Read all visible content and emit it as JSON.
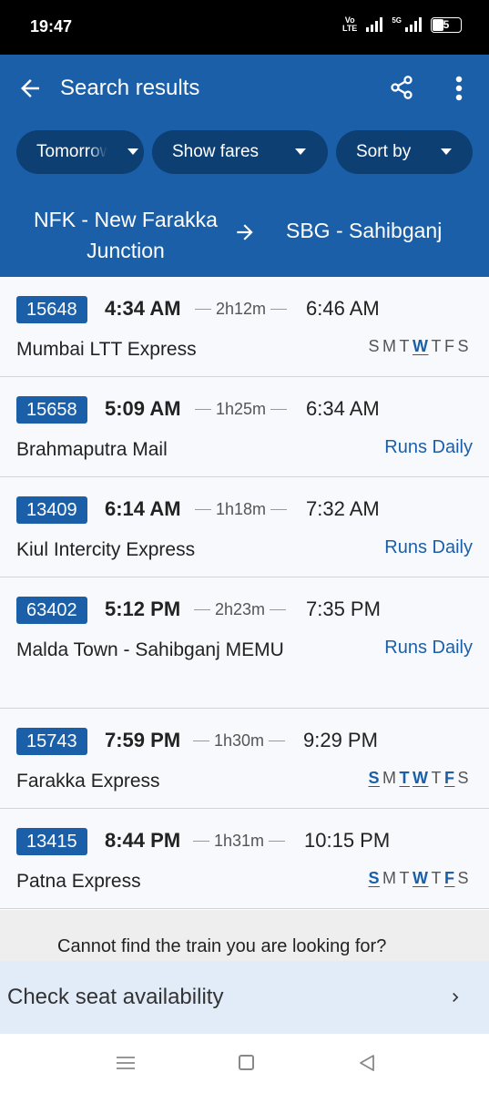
{
  "status": {
    "time": "19:47",
    "network_label": "Vo\nLTE",
    "g5": "5G",
    "battery": "5"
  },
  "header": {
    "title": "Search results"
  },
  "filters": {
    "date_label": "Tomorrow",
    "fares_label": "Show fares",
    "sort_label": "Sort by"
  },
  "route": {
    "from": "NFK - New Farakka Junction",
    "to": "SBG - Sahibganj"
  },
  "trains": [
    {
      "number": "15648",
      "dep": "4:34 AM",
      "dur": "2h12m",
      "arr": "6:46 AM",
      "name": "Mumbai LTT Express",
      "days": [
        {
          "d": "S",
          "on": false
        },
        {
          "d": "M",
          "on": false
        },
        {
          "d": "T",
          "on": false
        },
        {
          "d": "W",
          "on": true
        },
        {
          "d": "T",
          "on": false
        },
        {
          "d": "F",
          "on": false
        },
        {
          "d": "S",
          "on": false
        }
      ]
    },
    {
      "number": "15658",
      "dep": "5:09 AM",
      "dur": "1h25m",
      "arr": "6:34 AM",
      "name": "Brahmaputra Mail",
      "runs": "Runs Daily"
    },
    {
      "number": "13409",
      "dep": "6:14 AM",
      "dur": "1h18m",
      "arr": "7:32 AM",
      "name": "Kiul Intercity Express",
      "runs": "Runs Daily"
    },
    {
      "number": "63402",
      "dep": "5:12 PM",
      "dur": "2h23m",
      "arr": "7:35 PM",
      "name": "Malda Town - Sahibganj MEMU",
      "runs": "Runs Daily"
    },
    {
      "number": "15743",
      "dep": "7:59 PM",
      "dur": "1h30m",
      "arr": "9:29 PM",
      "name": "Farakka Express",
      "days": [
        {
          "d": "S",
          "on": true
        },
        {
          "d": "M",
          "on": false
        },
        {
          "d": "T",
          "on": true
        },
        {
          "d": "W",
          "on": true
        },
        {
          "d": "T",
          "on": false
        },
        {
          "d": "F",
          "on": true
        },
        {
          "d": "S",
          "on": false
        }
      ]
    },
    {
      "number": "13415",
      "dep": "8:44 PM",
      "dur": "1h31m",
      "arr": "10:15 PM",
      "name": "Patna Express",
      "days": [
        {
          "d": "S",
          "on": true
        },
        {
          "d": "M",
          "on": false
        },
        {
          "d": "T",
          "on": false
        },
        {
          "d": "W",
          "on": true
        },
        {
          "d": "T",
          "on": false
        },
        {
          "d": "F",
          "on": true
        },
        {
          "d": "S",
          "on": false
        }
      ]
    }
  ],
  "footer": {
    "not_found": "Cannot find the train you are looking for?",
    "check_seat": "Check seat availability"
  },
  "colors": {
    "primary": "#1a5fa8",
    "chip": "#0d3f73",
    "card_bg": "#f8f9fc",
    "banner_bg": "#e1ecf8"
  },
  "icons": {
    "back": "arrow-left-icon",
    "share": "share-icon",
    "more": "more-vert-icon",
    "route_arrow": "arrow-right-icon",
    "chevron": "chevron-right-icon"
  }
}
